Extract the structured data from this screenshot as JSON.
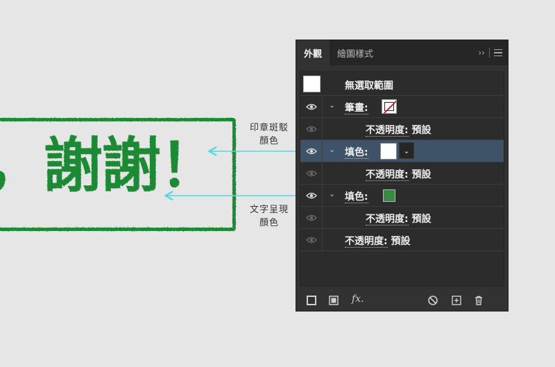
{
  "artwork": {
    "stamp_text": "，謝謝！",
    "stamp_color": "#1e8a34",
    "callout_top_line1": "印章斑駁",
    "callout_top_line2": "顏色",
    "callout_bottom_line1": "文字呈現",
    "callout_bottom_line2": "顏色",
    "arrow_color": "#4fd8e0"
  },
  "panel": {
    "tabs": [
      {
        "label": "外觀",
        "active": true
      },
      {
        "label": "繪圖樣式",
        "active": false
      }
    ],
    "tab_tools": {
      "expand": "››"
    },
    "rows": {
      "no_selection": "無選取範圍",
      "stroke_label": "筆畫:",
      "opacity_label_1": "不透明度:",
      "opacity_value_1": "預設",
      "fill1_label": "填色:",
      "opacity_label_2": "不透明度:",
      "opacity_value_2": "預設",
      "fill2_label": "填色:",
      "opacity_label_3": "不透明度:",
      "opacity_value_3": "預設",
      "opacity_label_4": "不透明度:",
      "opacity_value_4": "預設"
    },
    "colors": {
      "selected_row": "#3e5268",
      "fill1": "#ffffff",
      "fill2": "#3a8a44",
      "stroke_none": "#d0202b"
    },
    "footer_icons": [
      "add-stroke-icon",
      "add-fill-icon",
      "fx-icon",
      "clear-appearance-icon",
      "duplicate-item-icon",
      "delete-icon"
    ],
    "fx_label": "fx."
  }
}
